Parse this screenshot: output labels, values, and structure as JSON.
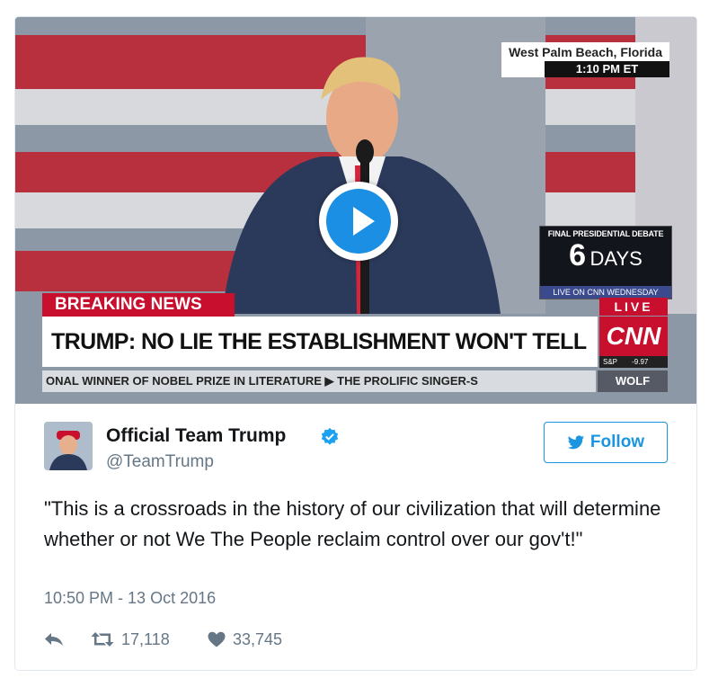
{
  "media": {
    "location": "West Palm Beach, Florida",
    "time": "1:10 PM ET",
    "debate_top": "FINAL PRESIDENTIAL DEBATE",
    "debate_days_num": "6",
    "debate_days_word": "DAYS",
    "debate_bottom": "LIVE ON CNN WEDNESDAY",
    "breaking_label": "BREAKING NEWS",
    "headline": "TRUMP: NO LIE THE ESTABLISHMENT WON'T TELL",
    "live_label": "LIVE",
    "network_logo": "CNN",
    "sp_label": "S&P",
    "sp_value": "-9.97",
    "ticker": "ONAL WINNER OF NOBEL PRIZE IN LITERATURE  ▶  THE PROLIFIC SINGER-S",
    "show_name": "WOLF"
  },
  "tweet": {
    "display_name": "Official Team Trump",
    "handle": "@TeamTrump",
    "follow_label": "Follow",
    "text": "\"This is a crossroads in the history of our civilization that will determine whether or not We The People reclaim control over our gov't!\"",
    "timestamp": "10:50 PM - 13 Oct 2016",
    "retweets": "17,118",
    "likes": "33,745"
  },
  "colors": {
    "twitter_blue": "#1b95e0",
    "cnn_red": "#c8102e",
    "text_primary": "#14171a",
    "text_secondary": "#657786"
  },
  "icons": [
    "play-icon",
    "verified-badge-icon",
    "twitter-bird-icon",
    "reply-icon",
    "retweet-icon",
    "heart-icon"
  ]
}
